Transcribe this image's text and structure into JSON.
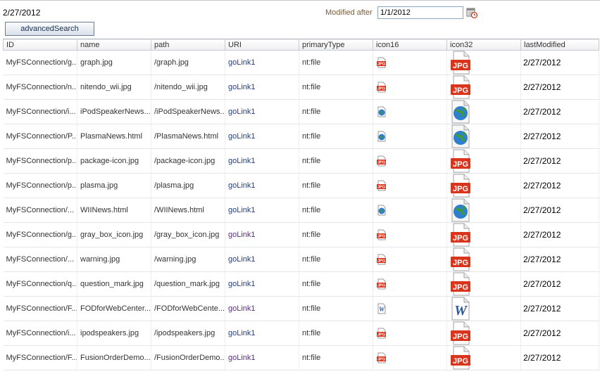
{
  "header": {
    "today": "2/27/2012",
    "modified_after_label": "Modified after",
    "modified_after_value": "1/1/2012",
    "advanced_search_label": "advancedSearch"
  },
  "table": {
    "columns": [
      "ID",
      "name",
      "path",
      "URI",
      "primaryType",
      "icon16",
      "icon32",
      "lastModified"
    ],
    "rows": [
      {
        "id": "MyFSConnection/g...",
        "name": "graph.jpg",
        "path": "/graph.jpg",
        "uri": "goLink1",
        "type": "nt:file",
        "icon": "jpg-icon",
        "last": "2/27/2012"
      },
      {
        "id": "MyFSConnection/n...",
        "name": "nitendo_wii.jpg",
        "path": "/nitendo_wii.jpg",
        "uri": "goLink1",
        "type": "nt:file",
        "icon": "jpg-icon",
        "last": "2/27/2012"
      },
      {
        "id": "MyFSConnection/i...",
        "name": "iPodSpeakerNews....",
        "path": "/iPodSpeakerNews...",
        "uri": "goLink1",
        "type": "nt:file",
        "icon": "html-icon",
        "last": "2/27/2012"
      },
      {
        "id": "MyFSConnection/P...",
        "name": "PlasmaNews.html",
        "path": "/PlasmaNews.html",
        "uri": "goLink1",
        "type": "nt:file",
        "icon": "html-icon",
        "last": "2/27/2012"
      },
      {
        "id": "MyFSConnection/p...",
        "name": "package-icon.jpg",
        "path": "/package-icon.jpg",
        "uri": "goLink1",
        "type": "nt:file",
        "icon": "jpg-icon",
        "last": "2/27/2012"
      },
      {
        "id": "MyFSConnection/p...",
        "name": "plasma.jpg",
        "path": "/plasma.jpg",
        "uri": "goLink1",
        "type": "nt:file",
        "icon": "jpg-icon",
        "last": "2/27/2012"
      },
      {
        "id": "MyFSConnection/...",
        "name": "WIINews.html",
        "path": "/WIINews.html",
        "uri": "goLink1",
        "type": "nt:file",
        "icon": "html-icon",
        "last": "2/27/2012"
      },
      {
        "id": "MyFSConnection/g...",
        "name": "gray_box_icon.jpg",
        "path": "/gray_box_icon.jpg",
        "uri": "goLink1",
        "type": "nt:file",
        "icon": "jpg-icon",
        "last": "2/27/2012"
      },
      {
        "id": "MyFSConnection/...",
        "name": "warning.jpg",
        "path": "/warning.jpg",
        "uri": "goLink1",
        "type": "nt:file",
        "icon": "jpg-icon",
        "last": "2/27/2012"
      },
      {
        "id": "MyFSConnection/q...",
        "name": "question_mark.jpg",
        "path": "/question_mark.jpg",
        "uri": "goLink1",
        "type": "nt:file",
        "icon": "jpg-icon",
        "last": "2/27/2012"
      },
      {
        "id": "MyFSConnection/F...",
        "name": "FODforWebCenter...",
        "path": "/FODforWebCente...",
        "uri": "goLink1",
        "type": "nt:file",
        "icon": "word-icon",
        "last": "2/27/2012"
      },
      {
        "id": "MyFSConnection/i...",
        "name": "ipodspeakers.jpg",
        "path": "/ipodspeakers.jpg",
        "uri": "goLink1",
        "type": "nt:file",
        "icon": "jpg-icon",
        "last": "2/27/2012"
      },
      {
        "id": "MyFSConnection/F...",
        "name": "FusionOrderDemo...",
        "path": "/FusionOrderDemo...",
        "uri": "goLink1",
        "type": "nt:file",
        "icon": "jpg-icon",
        "last": "2/27/2012"
      }
    ]
  },
  "colors": {
    "link": "#1f3f86",
    "link_visited": "#5b2b86",
    "label": "#7a5b3b",
    "jpg_red": "#d9341c"
  }
}
